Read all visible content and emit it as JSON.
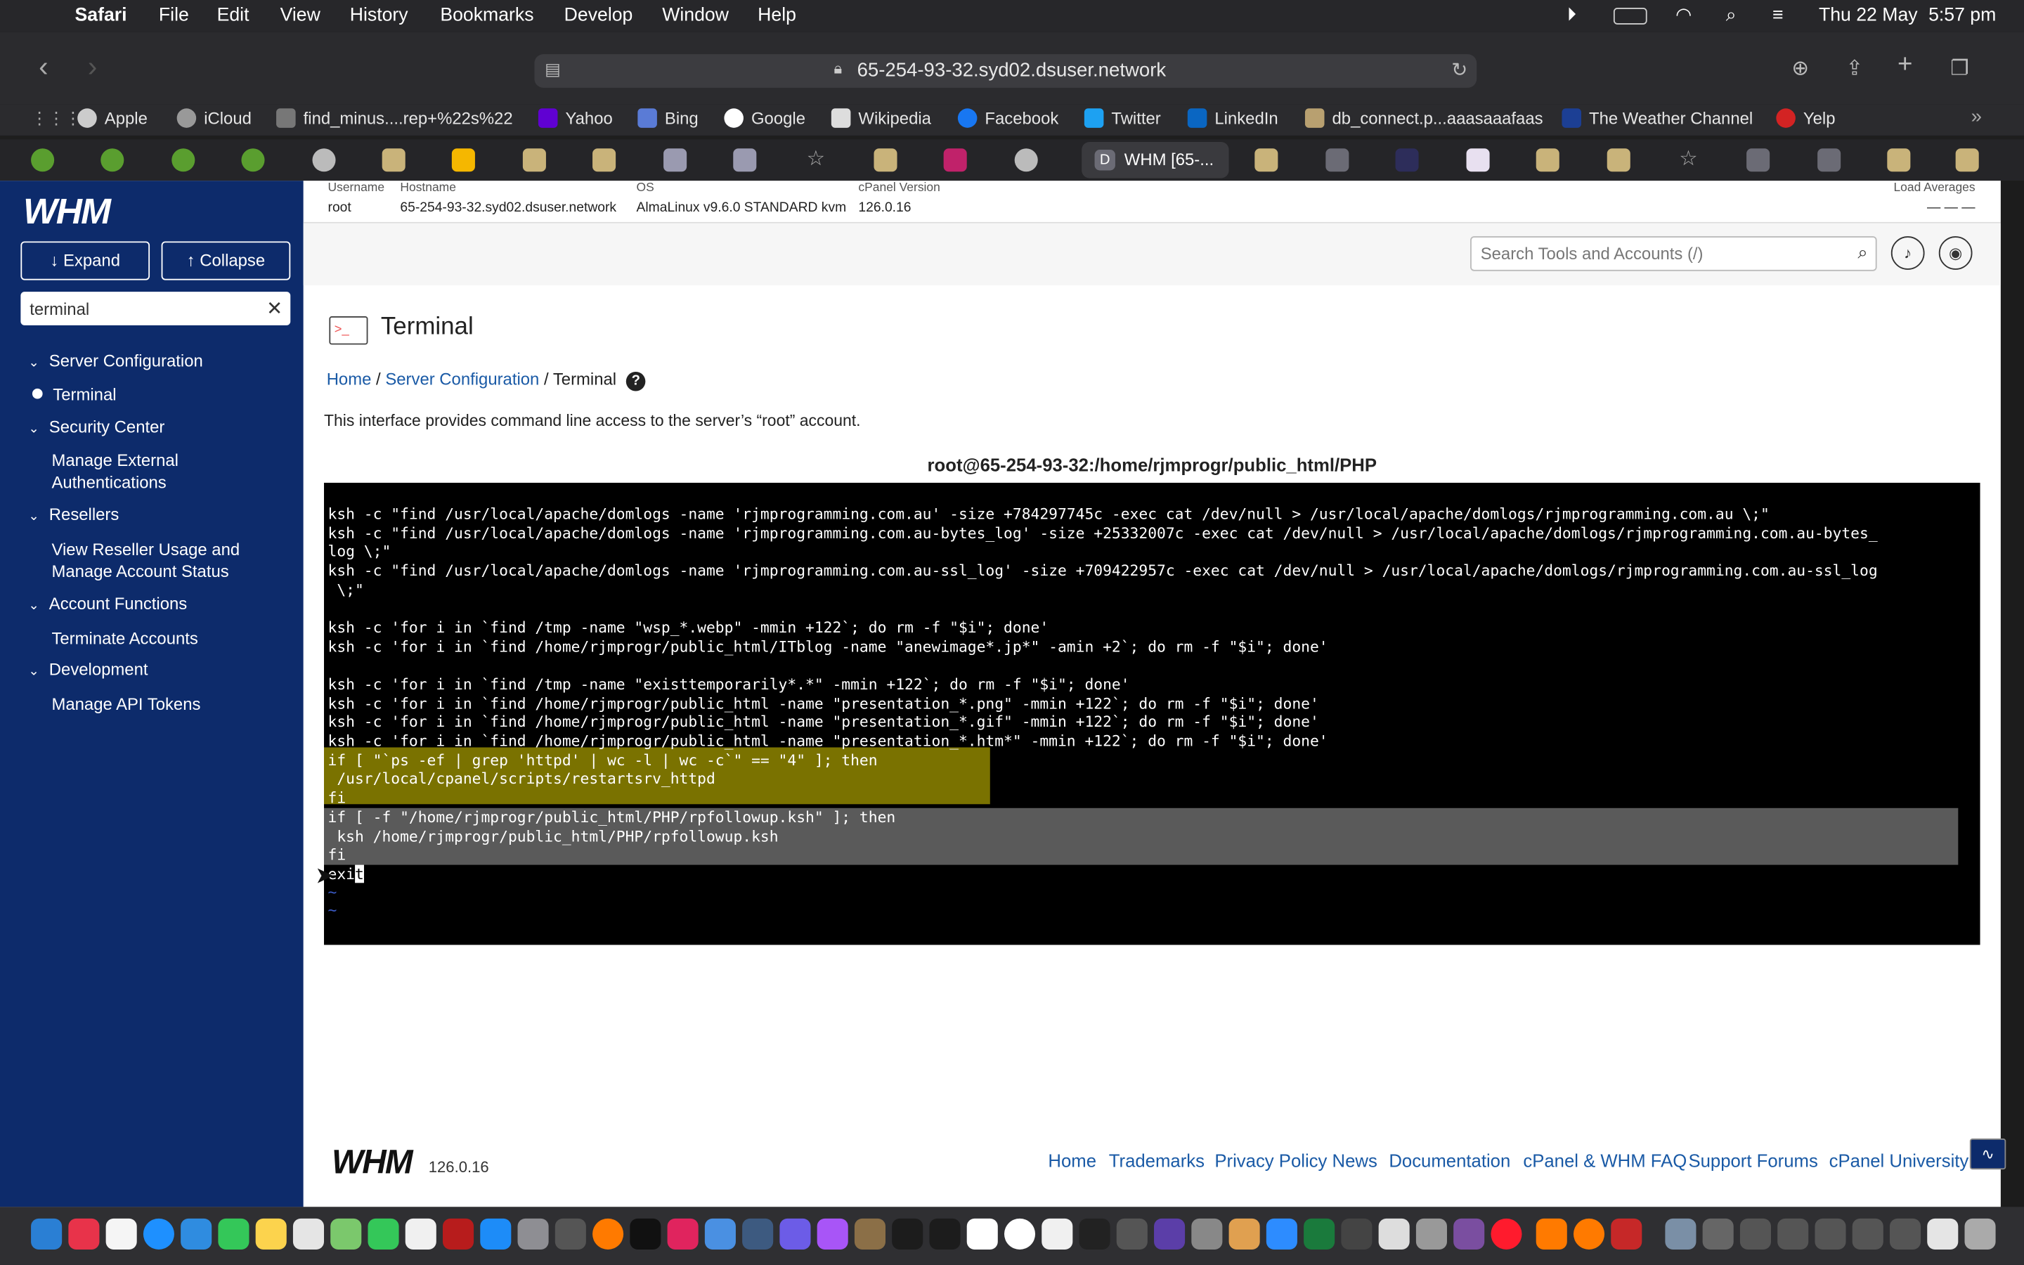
{
  "menubar": {
    "app": "Safari",
    "items": [
      "File",
      "Edit",
      "View",
      "History",
      "Bookmarks",
      "Develop",
      "Window",
      "Help"
    ],
    "date": "Thu 22 May",
    "time": "5:57 pm"
  },
  "toolbar": {
    "url": "65-254-93-32.syd02.dsuser.network"
  },
  "favorites": [
    "Apple",
    "iCloud",
    "find_minus....rep+%22s%22",
    "Yahoo",
    "Bing",
    "Google",
    "Wikipedia",
    "Facebook",
    "Twitter",
    "LinkedIn",
    "db_connect.p...aaasaaafaas",
    "The Weather Channel",
    "Yelp"
  ],
  "tabs": {
    "active_title": "WHM [65-..."
  },
  "sidebar": {
    "logo": "WHM",
    "expand": "↓ Expand",
    "collapse": "↑ Collapse",
    "filter": "terminal",
    "groups": [
      {
        "label": "Server Configuration"
      },
      {
        "label": "Security Center"
      },
      {
        "label": "Resellers"
      },
      {
        "label": "Account Functions"
      },
      {
        "label": "Development"
      }
    ],
    "items": [
      "Terminal",
      "Manage External",
      "Authentications",
      "View Reseller Usage and",
      "Manage Account Status",
      "Terminate Accounts",
      "Manage API Tokens"
    ]
  },
  "info": {
    "username_label": "Username",
    "username": "root",
    "hostname_label": "Hostname",
    "hostname": "65-254-93-32.syd02.dsuser.network",
    "os_label": "OS",
    "os": "AlmaLinux v9.6.0 STANDARD kvm",
    "cpanel_label": "cPanel Version",
    "cpanel": "126.0.16",
    "load_label": "Load Averages",
    "load": "—  —  —"
  },
  "search": {
    "placeholder": "Search Tools and Accounts (/)"
  },
  "main": {
    "title": "Terminal",
    "crumb_home": "Home",
    "crumb_section": "Server Configuration",
    "crumb_current": "Terminal",
    "description": "This interface provides command line access to the server’s “root” account.",
    "terminal_title": "root@65-254-93-32:/home/rjmprogr/public_html/PHP"
  },
  "terminal": {
    "lines": [
      "ksh -c \"find /usr/local/apache/domlogs -name 'rjmprogramming.com.au' -size +784297745c -exec cat /dev/null > /usr/local/apache/domlogs/rjmprogramming.com.au \\;\"",
      "ksh -c \"find /usr/local/apache/domlogs -name 'rjmprogramming.com.au-bytes_log' -size +25332007c -exec cat /dev/null > /usr/local/apache/domlogs/rjmprogramming.com.au-bytes_",
      "log \\;\"",
      "ksh -c \"find /usr/local/apache/domlogs -name 'rjmprogramming.com.au-ssl_log' -size +709422957c -exec cat /dev/null > /usr/local/apache/domlogs/rjmprogramming.com.au-ssl_log",
      " \\;\"",
      "",
      "ksh -c 'for i in `find /tmp -name \"wsp_*.webp\" -mmin +122`; do rm -f \"$i\"; done'",
      "ksh -c 'for i in `find /home/rjmprogr/public_html/ITblog -name \"anewimage*.jp*\" -amin +2`; do rm -f \"$i\"; done'",
      "",
      "ksh -c 'for i in `find /tmp -name \"existtemporarily*.*\" -mmin +122`; do rm -f \"$i\"; done'",
      "ksh -c 'for i in `find /home/rjmprogr/public_html -name \"presentation_*.png\" -mmin +122`; do rm -f \"$i\"; done'",
      "ksh -c 'for i in `find /home/rjmprogr/public_html -name \"presentation_*.gif\" -mmin +122`; do rm -f \"$i\"; done'",
      "ksh -c 'for i in `find /home/rjmprogr/public_html -name \"presentation_*.htm*\" -mmin +122`; do rm -f \"$i\"; done'",
      "if [ \"`ps -ef | grep 'httpd' | wc -l | wc -c`\" == \"4\" ]; then",
      " /usr/local/cpanel/scripts/restartsrv_httpd",
      "fi",
      "if [ -f \"/home/rjmprogr/public_html/PHP/rpfollowup.ksh\" ]; then",
      " ksh /home/rjmprogr/public_html/PHP/rpfollowup.ksh",
      "fi",
      "exi"
    ],
    "caret_char": "t",
    "tilde": "~"
  },
  "footer": {
    "logo": "WHM",
    "version": "126.0.16",
    "links": [
      "Home",
      "Trademarks",
      "Privacy Policy",
      "News",
      "Documentation",
      "cPanel & WHM FAQ",
      "Support Forums",
      "cPanel University"
    ]
  },
  "colors": {
    "sidebar": "#0d2b6b",
    "link": "#1a5aa6",
    "terminal_bg": "#000000",
    "highlight_yellow": "#7a7200",
    "highlight_gray": "#5a5a5a"
  }
}
